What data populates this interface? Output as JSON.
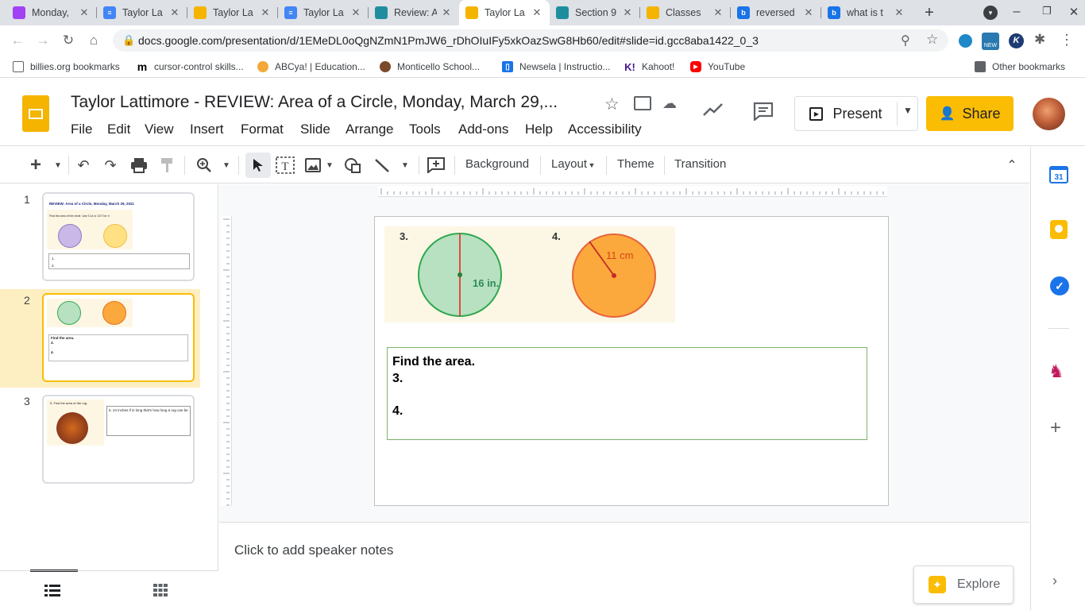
{
  "tabs": [
    {
      "title": "Monday,",
      "color": "#a142f4",
      "active": false
    },
    {
      "title": "Taylor La",
      "color": "#4285f4",
      "active": false
    },
    {
      "title": "Taylor La",
      "color": "#f4b400",
      "active": false
    },
    {
      "title": "Taylor La",
      "color": "#4285f4",
      "active": false
    },
    {
      "title": "Review: A",
      "color": "#1e8e9e",
      "active": false
    },
    {
      "title": "Taylor La",
      "color": "#f4b400",
      "active": true
    },
    {
      "title": "Section 9",
      "color": "#1e8e9e",
      "active": false
    },
    {
      "title": "Classes",
      "color": "#f4b400",
      "active": false
    },
    {
      "title": "reversed",
      "color": "#1a73e8",
      "active": false
    },
    {
      "title": "what is t",
      "color": "#1a73e8",
      "active": false
    }
  ],
  "address": {
    "url": "docs.google.com/presentation/d/1EMeDL0oQgNZmN1PmJW6_rDhOIuIFy5xkOazSwG8Hb60/edit#slide=id.gcc8aba1422_0_3"
  },
  "bookmarks": [
    {
      "label": "billies.org bookmarks"
    },
    {
      "label": "cursor-control skills..."
    },
    {
      "label": "ABCya! | Education..."
    },
    {
      "label": "Monticello School..."
    },
    {
      "label": "Newsela | Instructio..."
    },
    {
      "label": "Kahoot!"
    },
    {
      "label": "YouTube"
    }
  ],
  "other_bookmarks": "Other bookmarks",
  "doc": {
    "title": "Taylor Lattimore - REVIEW:  Area of a Circle, Monday, March 29,..."
  },
  "menus": [
    "File",
    "Edit",
    "View",
    "Insert",
    "Format",
    "Slide",
    "Arrange",
    "Tools",
    "Add-ons",
    "Help",
    "Accessibility"
  ],
  "header": {
    "present_label": "Present",
    "share_label": "Share"
  },
  "toolbar": {
    "background": "Background",
    "layout": "Layout",
    "theme": "Theme",
    "transition": "Transition"
  },
  "slides": [
    {
      "num": "1",
      "title": "REVIEW:  Area of a Circle, Monday, March 29, 2021",
      "instruction": "Find the area of the circle. Use 3.14 or 22/7 for π",
      "lines": [
        "1.",
        "2."
      ]
    },
    {
      "num": "2",
      "lines": [
        "Find the area.",
        "3.",
        "4."
      ]
    },
    {
      "num": "3",
      "heading": "5.  Find the area of the rug.",
      "answer": "5. 24 inches if in long that's how long a rug can be"
    }
  ],
  "slide": {
    "fig_left_num": "3.",
    "fig_left_label": "16 in.",
    "fig_right_num": "4.",
    "fig_right_label": "11 cm",
    "text_lines": [
      "Find the area.",
      "3.",
      "",
      "4."
    ]
  },
  "notes": {
    "placeholder": "Click to add speaker notes"
  },
  "explore": {
    "label": "Explore"
  },
  "colors": {
    "accent": "#fbbc04",
    "green": "#34a853",
    "orange": "#fba93c"
  }
}
